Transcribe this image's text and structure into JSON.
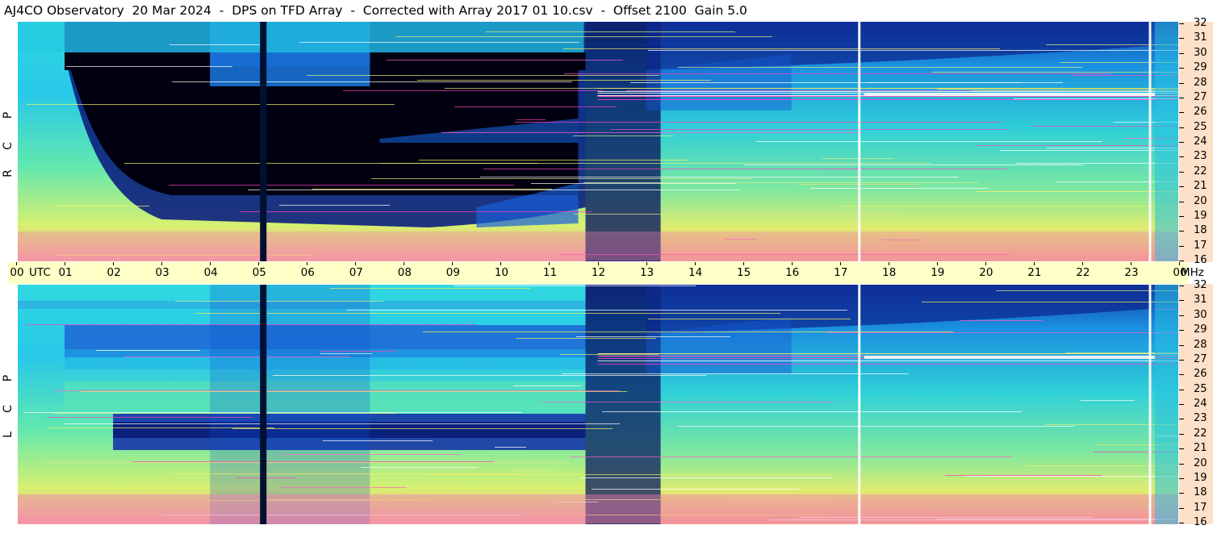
{
  "header": {
    "title": "AJ4CO Observatory  20 Mar 2024  -  DPS on TFD Array  -  Corrected with Array 2017 01 10.csv  -  Offset 2100  Gain 5.0"
  },
  "panels": {
    "top_label": [
      "R",
      "C",
      "P"
    ],
    "bottom_label": [
      "L",
      "C",
      "P"
    ]
  },
  "time_axis": {
    "labels": [
      "00",
      "01",
      "02",
      "03",
      "04",
      "05",
      "06",
      "07",
      "08",
      "09",
      "10",
      "11",
      "12",
      "13",
      "14",
      "15",
      "16",
      "17",
      "18",
      "19",
      "20",
      "21",
      "22",
      "23",
      "00"
    ],
    "utc_label": "UTC",
    "mhz_label": "MHz"
  },
  "freq_axis": {
    "labels": [
      "32",
      "31",
      "30",
      "29",
      "28",
      "27",
      "26",
      "25",
      "24",
      "23",
      "22",
      "21",
      "20",
      "19",
      "18",
      "17",
      "16"
    ]
  },
  "chart_data": [
    {
      "type": "heatmap",
      "title": "AJ4CO Observatory  20 Mar 2024  -  DPS on TFD Array  -  Corrected with Array 2017 01 10.csv  -  Offset 2100  Gain 5.0",
      "panel": "RCP",
      "xlabel": "UTC",
      "ylabel": "MHz",
      "x_ticks": [
        "00",
        "01",
        "02",
        "03",
        "04",
        "05",
        "06",
        "07",
        "08",
        "09",
        "10",
        "11",
        "12",
        "13",
        "14",
        "15",
        "16",
        "17",
        "18",
        "19",
        "20",
        "21",
        "22",
        "23",
        "00"
      ],
      "y_ticks": [
        32,
        31,
        30,
        29,
        28,
        27,
        26,
        25,
        24,
        23,
        22,
        21,
        20,
        19,
        18,
        17,
        16
      ],
      "xlim": [
        0,
        24
      ],
      "ylim": [
        16,
        32
      ],
      "colormap": [
        "#000018",
        "#0a1a66",
        "#1060e0",
        "#20d8e8",
        "#60f0a0",
        "#e8f060",
        "#f8a880",
        "#ff40c0",
        "#ffffff"
      ],
      "features": {
        "night_dark_region_hours": [
          1.5,
          11.8
        ],
        "vertical_spike_hours": [
          5.1,
          17.4,
          23.4
        ]
      }
    },
    {
      "type": "heatmap",
      "panel": "LCP",
      "xlabel": "UTC",
      "ylabel": "MHz",
      "x_ticks": [
        "00",
        "01",
        "02",
        "03",
        "04",
        "05",
        "06",
        "07",
        "08",
        "09",
        "10",
        "11",
        "12",
        "13",
        "14",
        "15",
        "16",
        "17",
        "18",
        "19",
        "20",
        "21",
        "22",
        "23",
        "00"
      ],
      "y_ticks": [
        32,
        31,
        30,
        29,
        28,
        27,
        26,
        25,
        24,
        23,
        22,
        21,
        20,
        19,
        18,
        17,
        16
      ],
      "xlim": [
        0,
        24
      ],
      "ylim": [
        16,
        32
      ],
      "colormap": [
        "#000018",
        "#0a1a66",
        "#1060e0",
        "#20d8e8",
        "#60f0a0",
        "#e8f060",
        "#f8a880",
        "#ff40c0",
        "#ffffff"
      ],
      "features": {
        "vertical_spike_hours": [
          5.1,
          17.4,
          23.4
        ]
      }
    }
  ]
}
